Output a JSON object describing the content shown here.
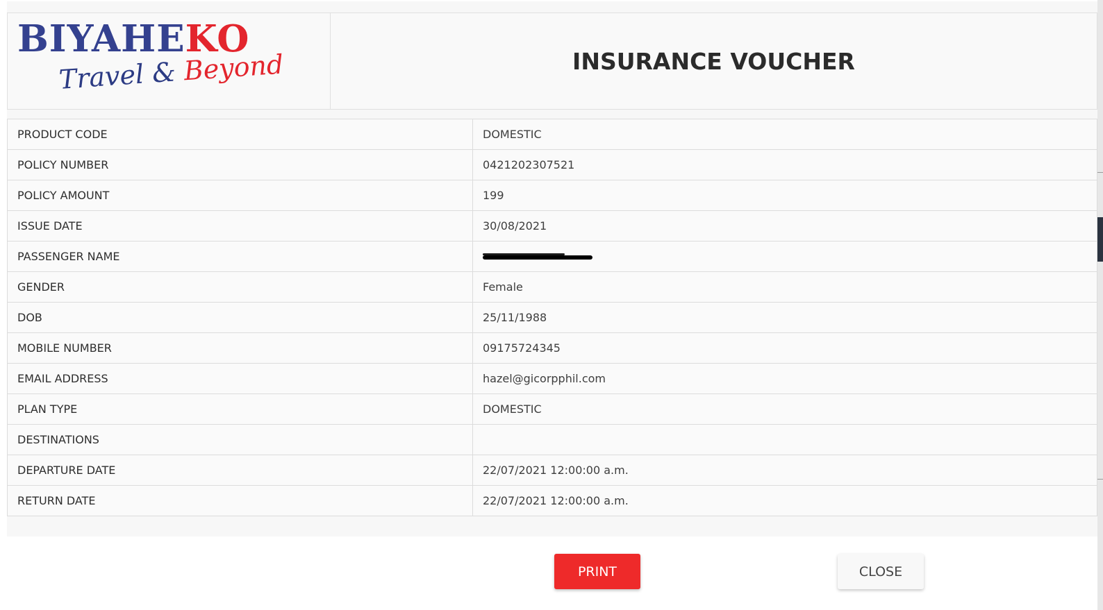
{
  "logo": {
    "word_part1": "BIYAHE",
    "word_part2": "KO",
    "tagline_part1": "Travel",
    "tagline_amp": " & ",
    "tagline_part2": "Beyond"
  },
  "header": {
    "title": "INSURANCE VOUCHER"
  },
  "details": {
    "rows": [
      {
        "label": "PRODUCT CODE",
        "value": "DOMESTIC"
      },
      {
        "label": "POLICY NUMBER",
        "value": "0421202307521"
      },
      {
        "label": "POLICY AMOUNT",
        "value": "199"
      },
      {
        "label": "ISSUE DATE",
        "value": "30/08/2021"
      },
      {
        "label": "PASSENGER NAME",
        "value": ""
      },
      {
        "label": "GENDER",
        "value": "Female"
      },
      {
        "label": "DOB",
        "value": "25/11/1988"
      },
      {
        "label": "MOBILE NUMBER",
        "value": "09175724345"
      },
      {
        "label": "EMAIL ADDRESS",
        "value": "hazel@gicorpphil.com"
      },
      {
        "label": "PLAN TYPE",
        "value": "DOMESTIC"
      },
      {
        "label": "DESTINATIONS",
        "value": ""
      },
      {
        "label": "DEPARTURE DATE",
        "value": "22/07/2021 12:00:00 a.m."
      },
      {
        "label": "RETURN DATE",
        "value": "22/07/2021 12:00:00 a.m."
      }
    ]
  },
  "actions": {
    "print_label": "PRINT",
    "close_label": "CLOSE"
  },
  "colors": {
    "brand_blue": "#34418f",
    "brand_red": "#e3252d",
    "print_button": "#ee2a2a"
  }
}
